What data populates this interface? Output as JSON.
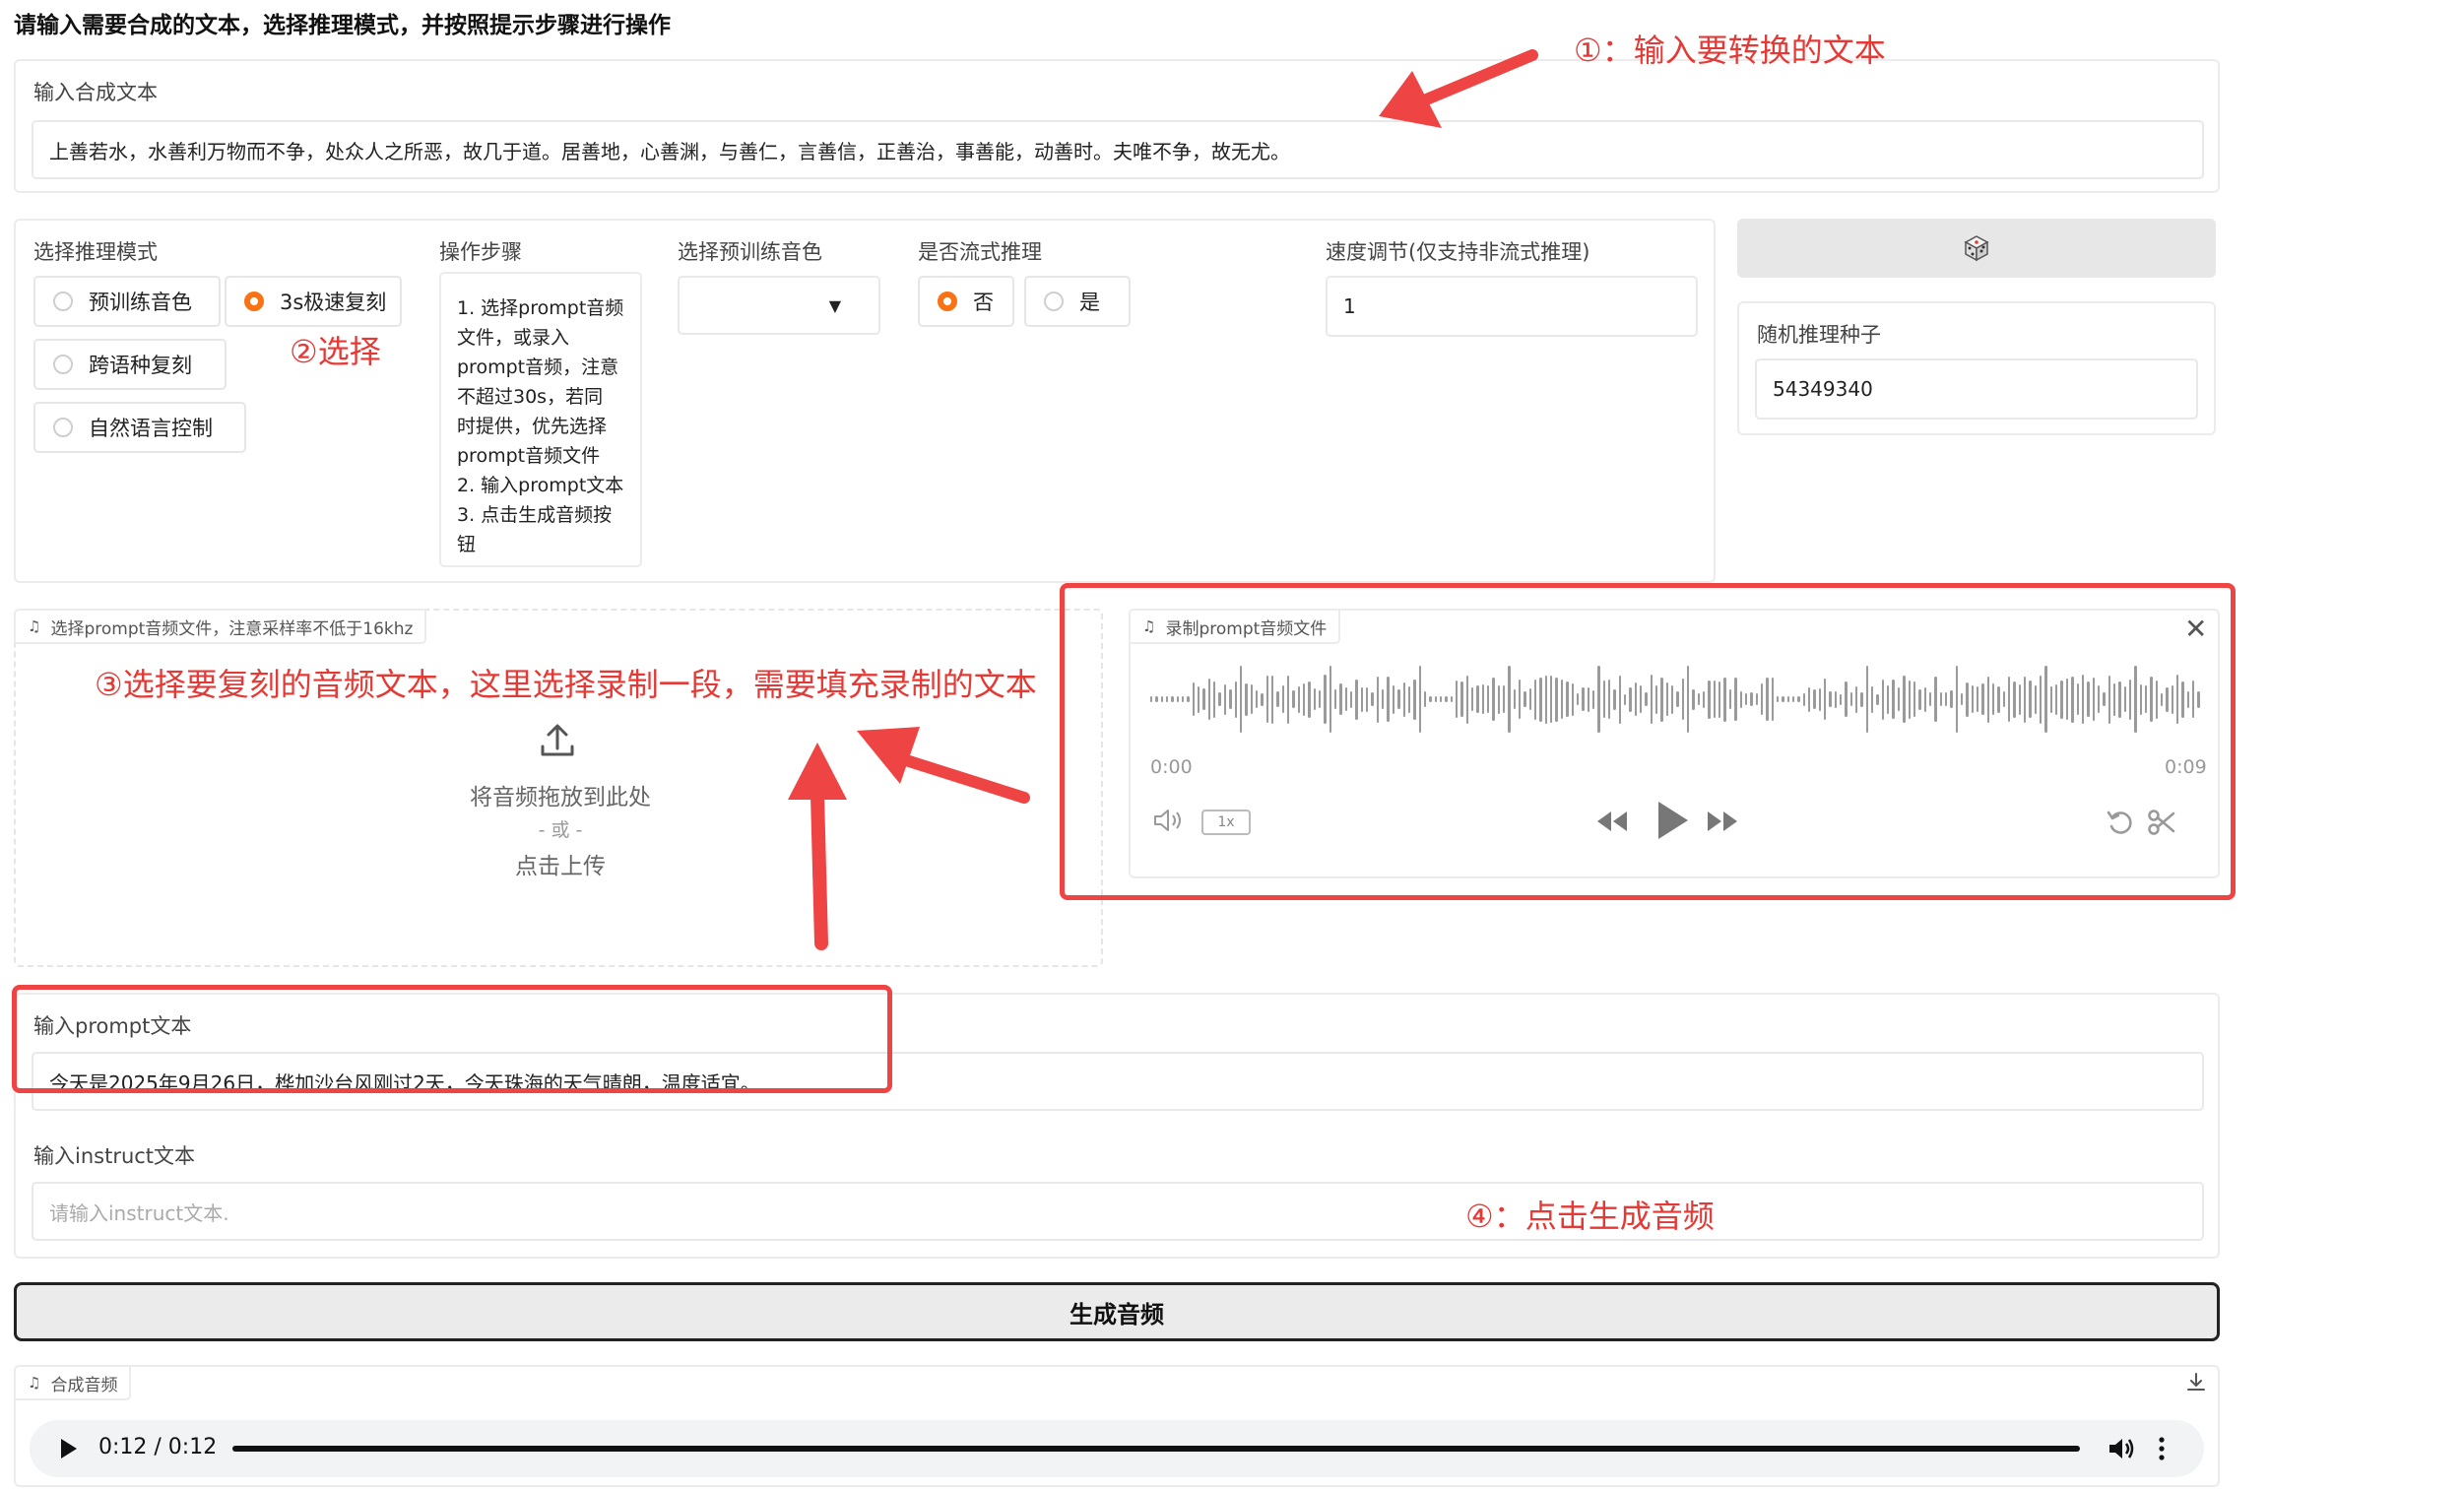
{
  "header": {
    "instruction": "请输入需要合成的文本，选择推理模式，并按照提示步骤进行操作"
  },
  "synth_text": {
    "label": "输入合成文本",
    "value": "上善若水，水善利万物而不争，处众人之所恶，故几于道。居善地，心善渊，与善仁，言善信，正善治，事善能，动善时。夫唯不争，故无尤。"
  },
  "mode": {
    "label": "选择推理模式",
    "options": [
      "预训练音色",
      "3s极速复刻",
      "跨语种复刻",
      "自然语言控制"
    ],
    "selected": "3s极速复刻"
  },
  "steps": {
    "label": "操作步骤",
    "lines": [
      "1. 选择prompt音频",
      "文件，或录入",
      "prompt音频，注意",
      "不超过30s，若同",
      "时提供，优先选择",
      "prompt音频文件",
      "2. 输入prompt文本",
      "3. 点击生成音频按",
      "钮"
    ]
  },
  "voice": {
    "label": "选择预训练音色",
    "value": ""
  },
  "stream": {
    "label": "是否流式推理",
    "options": [
      "否",
      "是"
    ],
    "selected": "否"
  },
  "speed": {
    "label": "速度调节(仅支持非流式推理)",
    "value": "1"
  },
  "seed": {
    "button_icon": "dice-icon",
    "label": "随机推理种子",
    "value": "54349340"
  },
  "upload": {
    "tag": "选择prompt音频文件，注意采样率不低于16khz",
    "drop_text": "将音频拖放到此处",
    "or_text": "- 或 -",
    "click_text": "点击上传"
  },
  "record": {
    "tag": "录制prompt音频文件",
    "time_start": "0:00",
    "time_end": "0:09",
    "speed_badge": "1x"
  },
  "prompt_text": {
    "label": "输入prompt文本",
    "value": "今天是2025年9月26日，桦加沙台风刚过2天，今天珠海的天气晴朗，温度适宜。"
  },
  "instruct_text": {
    "label": "输入instruct文本",
    "placeholder": "请输入instruct文本."
  },
  "generate_button": "生成音频",
  "output": {
    "tag": "合成音频",
    "time": "0:12 / 0:12",
    "progress": 1.0
  },
  "annotations": {
    "a1": "①：输入要转换的文本",
    "a2": "②选择",
    "a3": "③选择要复刻的音频文本，这里选择录制一段，需要填充录制的文本",
    "a4": "④：点击生成音频"
  },
  "colors": {
    "accent": "#f97316",
    "annotation_red": "#ef4444"
  }
}
